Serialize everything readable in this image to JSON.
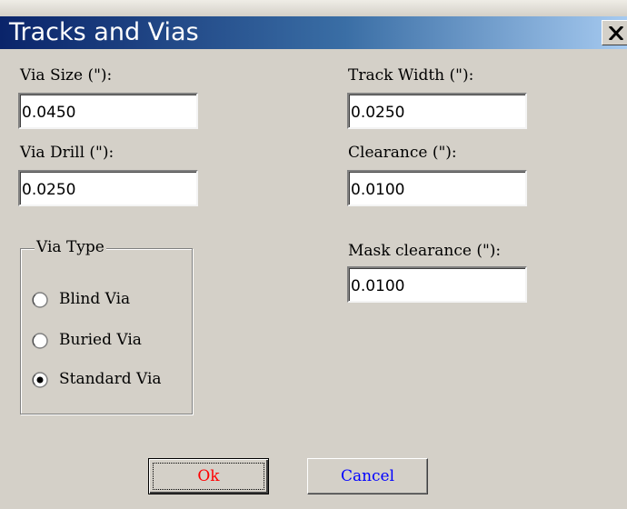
{
  "window": {
    "title": "Tracks and Vias",
    "close_glyph": "✕"
  },
  "fields": {
    "via_size": {
      "label": "Via Size (\"):",
      "value": "0.0450"
    },
    "via_drill": {
      "label": "Via Drill (\"):",
      "value": "0.0250"
    },
    "track_width": {
      "label": "Track Width (\"):",
      "value": "0.0250"
    },
    "clearance": {
      "label": "Clearance (\"):",
      "value": "0.0100"
    },
    "mask_clearance": {
      "label": "Mask clearance (\"):",
      "value": "0.0100"
    }
  },
  "via_type": {
    "legend": "Via Type",
    "options": [
      {
        "label": "Blind Via",
        "selected": false
      },
      {
        "label": "Buried Via",
        "selected": false
      },
      {
        "label": "Standard Via",
        "selected": true
      }
    ]
  },
  "buttons": {
    "ok": {
      "label": "Ok",
      "color": "#ff0000"
    },
    "cancel": {
      "label": "Cancel",
      "color": "#0000ff"
    }
  }
}
